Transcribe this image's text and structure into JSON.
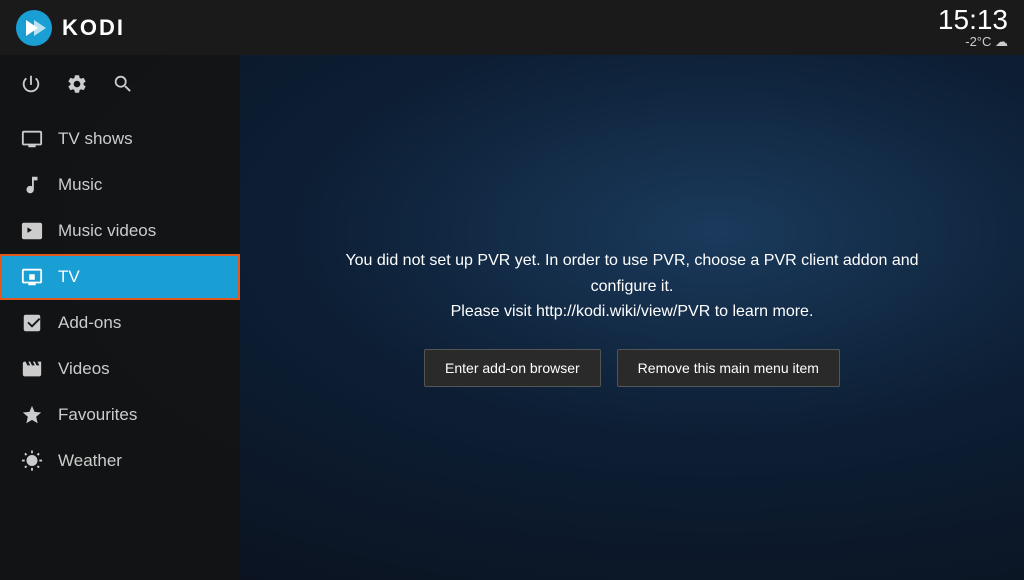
{
  "header": {
    "title": "KODI",
    "clock": "15:13",
    "weather": "-2°C ☁"
  },
  "sidebar": {
    "controls": {
      "power_label": "power",
      "settings_label": "settings",
      "search_label": "search"
    },
    "items": [
      {
        "id": "tv-shows",
        "label": "TV shows",
        "icon": "tv-icon",
        "active": false
      },
      {
        "id": "music",
        "label": "Music",
        "icon": "music-icon",
        "active": false
      },
      {
        "id": "music-videos",
        "label": "Music videos",
        "icon": "music-video-icon",
        "active": false
      },
      {
        "id": "tv",
        "label": "TV",
        "icon": "tv-live-icon",
        "active": true
      },
      {
        "id": "add-ons",
        "label": "Add-ons",
        "icon": "addons-icon",
        "active": false
      },
      {
        "id": "videos",
        "label": "Videos",
        "icon": "videos-icon",
        "active": false
      },
      {
        "id": "favourites",
        "label": "Favourites",
        "icon": "star-icon",
        "active": false
      },
      {
        "id": "weather",
        "label": "Weather",
        "icon": "weather-icon",
        "active": false
      }
    ]
  },
  "main": {
    "pvr_message_line1": "You did not set up PVR yet. In order to use PVR, choose a PVR client addon and configure it.",
    "pvr_message_line2": "Please visit http://kodi.wiki/view/PVR to learn more.",
    "btn_addon_browser": "Enter add-on browser",
    "btn_remove_item": "Remove this main menu item"
  }
}
